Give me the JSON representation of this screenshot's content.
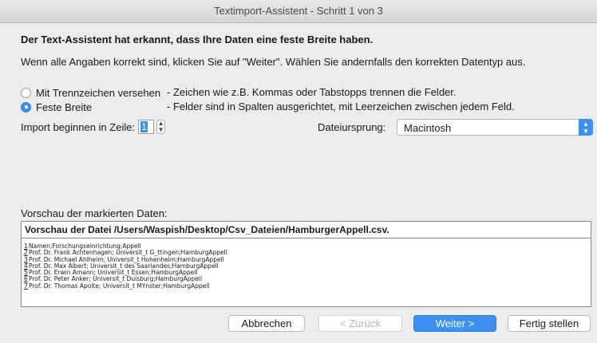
{
  "window": {
    "title": "Textimport-Assistent - Schritt 1 von 3"
  },
  "heading": "Der Text-Assistent hat erkannt, dass Ihre Daten eine feste Breite haben.",
  "intro": "Wenn alle Angaben korrekt sind, klicken Sie auf \"Weiter\". Wählen Sie andernfalls den korrekten Datentyp aus.",
  "options": [
    {
      "label": "Mit Trennzeichen versehen",
      "description": "- Zeichen wie z.B. Kommas oder Tabstopps trennen die Felder.",
      "selected": false
    },
    {
      "label": "Feste Breite",
      "description": "- Felder sind in Spalten ausgerichtet, mit Leerzeichen zwischen jedem Feld.",
      "selected": true
    }
  ],
  "import_start": {
    "label": "Import beginnen in Zeile:",
    "value": "1"
  },
  "origin": {
    "label": "Dateiursprung:",
    "value": "Macintosh"
  },
  "preview": {
    "label": "Vorschau der markierten Daten:",
    "header": "Vorschau der Datei /Users/Waspish/Desktop/Csv_Dateien/HamburgerAppell.csv.",
    "lines": [
      {
        "num": "1",
        "text": "Namen;Forschungseinrichtung;Appell"
      },
      {
        "num": "2",
        "text": "Prof. Dr. Frank Achtenhagen; Universit_t G_ttingen;HamburgAppell"
      },
      {
        "num": "3",
        "text": "Prof. Dr. Michael Ahlheim; Universit_t Hohenheim;HamburgAppell"
      },
      {
        "num": "4",
        "text": "Prof. Dr. Max Albert; Universit_t des Saarlandes;HamburgAppell"
      },
      {
        "num": "5",
        "text": "Prof. Dr. Erwin Amann; Universit_t Essen;HamburgAppell"
      },
      {
        "num": "6",
        "text": "Prof. Dr. Peter Anker; Universit_t Duisburg;HamburgAppell"
      },
      {
        "num": "7",
        "text": "Prof. Dr. Thomas Apolte; Universit_t MYnster;HamburgAppell"
      }
    ]
  },
  "buttons": {
    "cancel": "Abbrechen",
    "back": "< Zurück",
    "next": "Weiter >",
    "finish": "Fertig stellen"
  },
  "colors": {
    "accent": "#3d8ff0",
    "window_bg": "#ececec"
  }
}
